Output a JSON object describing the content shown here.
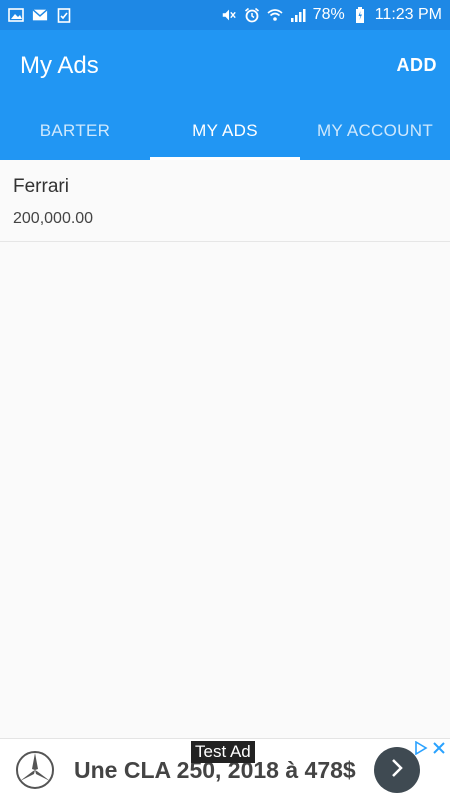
{
  "status_bar": {
    "battery": "78%",
    "time": "11:23 PM",
    "icons_left": [
      "image-icon",
      "mail-icon",
      "checklist-icon"
    ],
    "icons_right": [
      "mute-icon",
      "alarm-icon",
      "wifi-icon",
      "signal-icon",
      "battery-icon"
    ]
  },
  "app_bar": {
    "title": "My Ads",
    "add_label": "ADD"
  },
  "tabs": [
    {
      "label": "BARTER",
      "active": false
    },
    {
      "label": "MY ADS",
      "active": true
    },
    {
      "label": "MY ACCOUNT",
      "active": false
    }
  ],
  "ads": [
    {
      "name": "Ferrari",
      "price": "200,000.00"
    }
  ],
  "banner": {
    "test_label": "Test Ad",
    "text": "Une CLA 250, 2018 à 478$"
  },
  "colors": {
    "status_bar": "#1e88e5",
    "primary": "#2196f3",
    "background": "#fafafa",
    "arrow_button": "#3f4a52",
    "ad_choice": "#2aa2ff"
  }
}
